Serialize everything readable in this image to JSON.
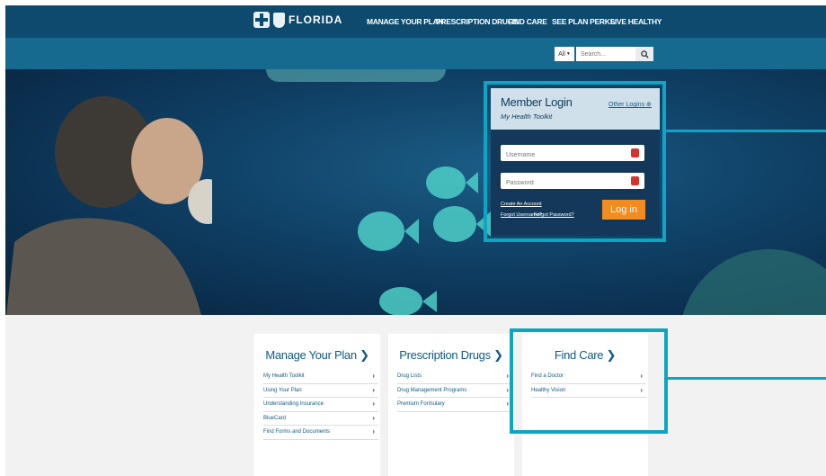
{
  "brand": {
    "name": "FLORIDA"
  },
  "nav": {
    "links": [
      "MANAGE YOUR PLAN",
      "PRESCRIPTION DRUGS",
      "FIND CARE",
      "SEE PLAN PERKS",
      "LIVE HEALTHY"
    ]
  },
  "search": {
    "scope": "All",
    "placeholder": "Search..."
  },
  "login": {
    "title": "Member Login",
    "subtitle": "My Health Toolkit",
    "other_logins": "Other Logins",
    "username_placeholder": "Username",
    "password_placeholder": "Password",
    "create_account": "Create An Account",
    "forgot_username": "Forgot Username?",
    "forgot_password": "Forgot Password?",
    "submit": "Log in"
  },
  "cards": [
    {
      "title": "Manage Your Plan",
      "items": [
        "My Health Toolkit",
        "Using Your Plan",
        "Understanding Insurance",
        "BlueCard",
        "Find Forms and Documents"
      ]
    },
    {
      "title": "Prescription Drugs",
      "items": [
        "Drug Lists",
        "Drug Management Programs",
        "Premium Formulary"
      ]
    },
    {
      "title": "Find Care",
      "items": [
        "Find a Doctor",
        "Healthy Vision"
      ]
    }
  ],
  "colors": {
    "nav_bg": "#0d4a6e",
    "search_bar_bg": "#16698f",
    "accent_outline": "#0ea5c4",
    "login_button": "#f28c1e",
    "link": "#0e5b83"
  }
}
